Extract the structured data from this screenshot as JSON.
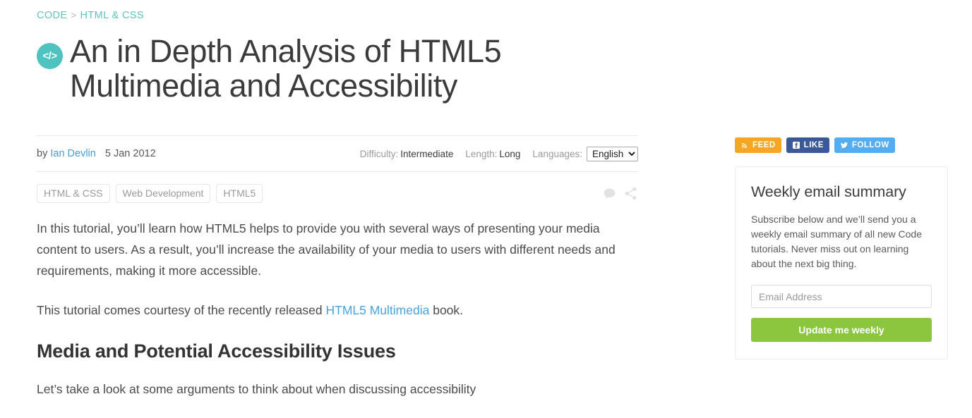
{
  "breadcrumb": {
    "items": [
      "CODE",
      "HTML & CSS"
    ],
    "separator": ">",
    "link_color": "#5cc4bf"
  },
  "article": {
    "category_icon": "code-tag-icon",
    "category_icon_glyph": "</>",
    "badge_color": "#4ec3bf",
    "title": "An in Depth Analysis of HTML5 Multimedia and Accessibility",
    "byline_prefix": "by",
    "author": "Ian Devlin",
    "date": "5 Jan 2012",
    "meta": [
      {
        "label": "Difficulty:",
        "value": "Intermediate"
      },
      {
        "label": "Length:",
        "value": "Long"
      }
    ],
    "languages_label": "Languages:",
    "languages_selected": "English",
    "languages_options": [
      "English"
    ],
    "tags": [
      "HTML & CSS",
      "Web Development",
      "HTML5"
    ],
    "row_icons": [
      "comment-icon",
      "share-icon"
    ],
    "paragraph_1": "In this tutorial, you’ll learn how HTML5 helps to provide you with several ways of presenting your media content to users. As a result, you’ll increase the availability of your media to users with different needs and requirements, making it more accessible.",
    "paragraph_2_before": "This tutorial comes courtesy of the recently released ",
    "paragraph_2_link": "HTML5 Multimedia",
    "paragraph_2_after": " book.",
    "section_heading": "Media and Potential Accessibility Issues",
    "clipped_paragraph": "Let’s take a look at some arguments to think about when discussing accessibility"
  },
  "sidebar": {
    "social_buttons": [
      {
        "label": "FEED",
        "icon": "rss-icon",
        "color": "#f5a623"
      },
      {
        "label": "LIKE",
        "icon": "facebook-icon",
        "color": "#3b5998"
      },
      {
        "label": "FOLLOW",
        "icon": "twitter-icon",
        "color": "#55acee"
      }
    ],
    "newsletter": {
      "title": "Weekly email summary",
      "description": "Subscribe below and we’ll send you a weekly email summary of all new Code tutorials. Never miss out on learning about the next big thing.",
      "email_value": "",
      "email_placeholder": "Email Address",
      "submit_label": "Update me weekly",
      "submit_color": "#8cc63e"
    }
  }
}
